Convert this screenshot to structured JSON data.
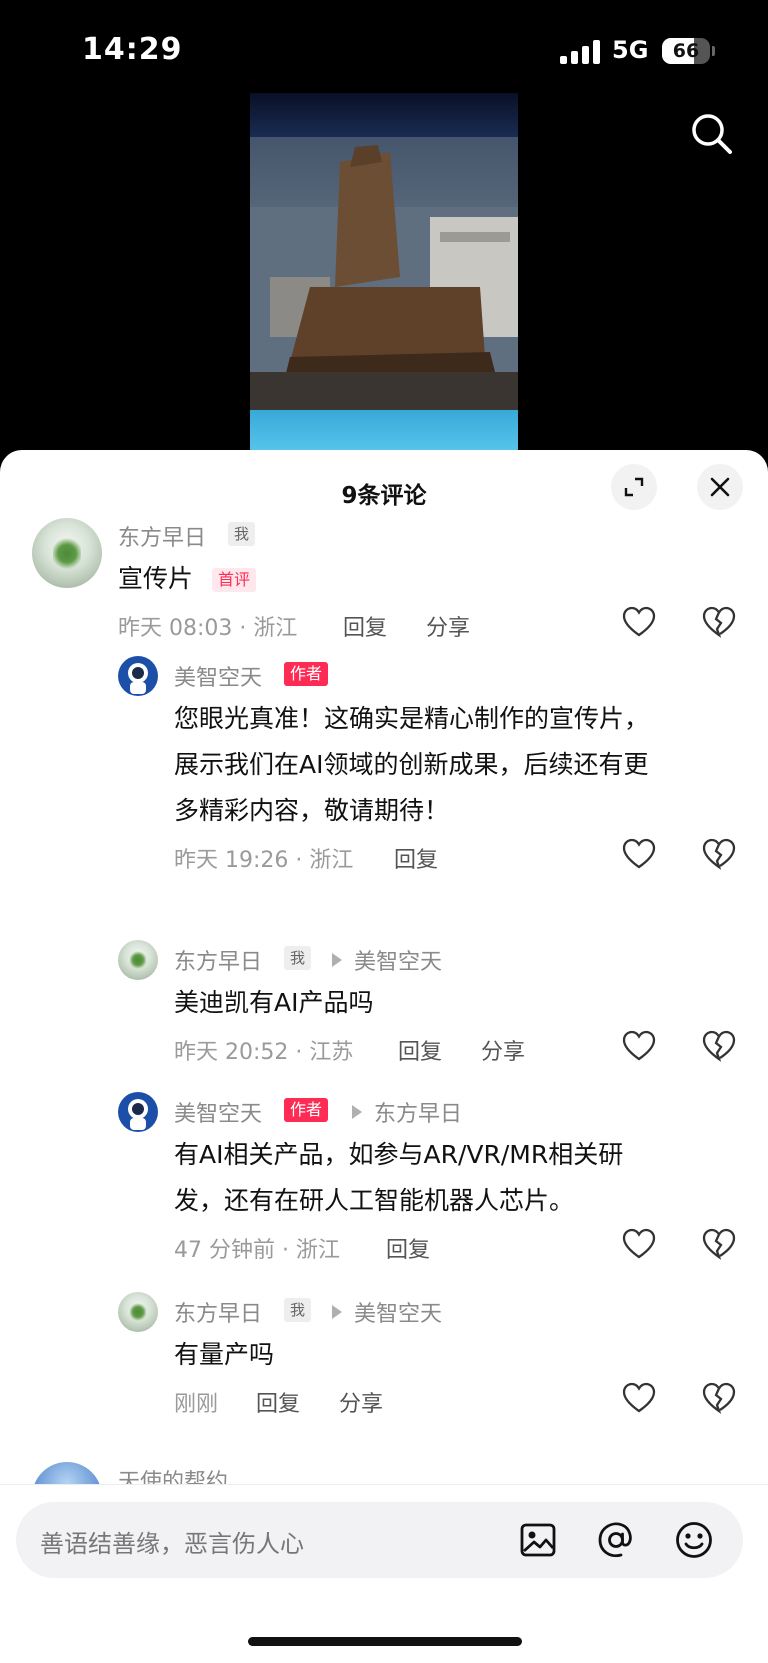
{
  "status_bar": {
    "time": "14:29",
    "network": "5G",
    "battery_level": 66,
    "battery_label": "66"
  },
  "sheet": {
    "title": "9条评论"
  },
  "comments": [
    {
      "user": "东方早日",
      "badge_me": "我",
      "text": "宣传片",
      "badge_first": "首评",
      "time_loc": "昨天 08:03 · 浙江",
      "reply": "回复",
      "share": "分享"
    },
    {
      "user": "美智空天",
      "badge_author": "作者",
      "text_lines": [
        "您眼光真准！这确实是精心制作的宣传片，",
        "展示我们在AI领域的创新成果，后续还有更",
        "多精彩内容，敬请期待！"
      ],
      "time_loc": "昨天 19:26 · 浙江",
      "reply": "回复"
    },
    {
      "user": "东方早日",
      "badge_me": "我",
      "reply_to": "美智空天",
      "text": "美迪凯有AI产品吗",
      "time_loc": "昨天 20:52 · 江苏",
      "reply": "回复",
      "share": "分享"
    },
    {
      "user": "美智空天",
      "badge_author": "作者",
      "reply_to": "东方早日",
      "text_lines": [
        "有AI相关产品，如参与AR/VR/MR相关研",
        "发，还有在研人工智能机器人芯片。"
      ],
      "time_loc": "47 分钟前 · 浙江",
      "reply": "回复"
    },
    {
      "user": "东方早日",
      "badge_me": "我",
      "reply_to": "美智空天",
      "text": "有量产吗",
      "time_loc": "刚刚",
      "reply": "回复",
      "share": "分享"
    },
    {
      "user": "天使的帮约"
    }
  ],
  "input": {
    "placeholder": "善语结善缘，恶言伤人心"
  },
  "icons": [
    "search-icon",
    "expand-icon",
    "close-icon",
    "heart-icon",
    "broken-heart-icon",
    "image-icon",
    "at-icon",
    "emoji-icon"
  ]
}
